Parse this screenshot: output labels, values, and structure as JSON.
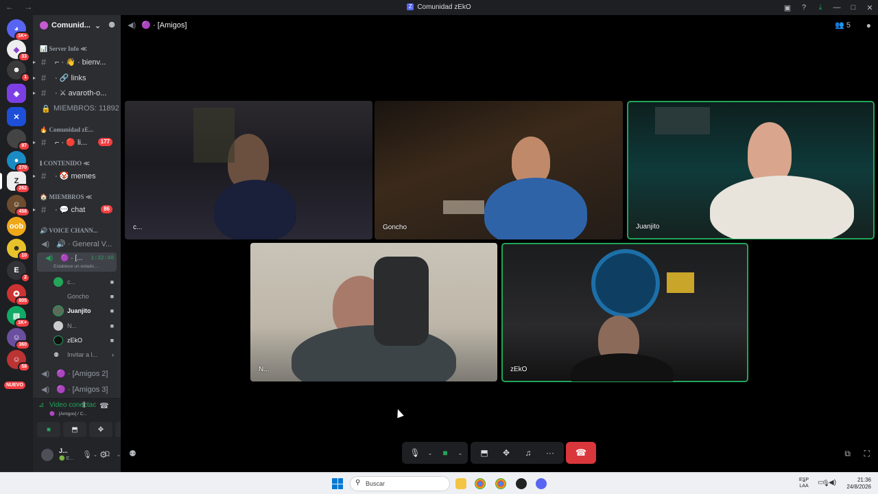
{
  "window": {
    "title": "Comunidad zEkO"
  },
  "guild_badges": [
    "1K+",
    "33",
    "1",
    "",
    "",
    "97",
    "270",
    "262",
    "458",
    "",
    "10",
    "2",
    "805",
    "1K+",
    "360",
    "58"
  ],
  "guild_letter": "E",
  "nuevo": "NUEVO",
  "server": {
    "name": "Comunid..."
  },
  "sidebar": {
    "cat_server_info": "📊 Server Info ≪",
    "ch_bienvenida": "⌐ · 👋 · bienv...",
    "ch_links": "· 🔗 links",
    "ch_avaroth": "· ⚔ avaroth-o...",
    "ch_miembros_count": "MIEMBROS: 11892",
    "cat_comunidad": "🔥 Comunidad zE...",
    "ch_li": "⌐ · 🔴 li...",
    "ch_li_count": "177",
    "cat_contenido": "ℹ CONTENIDO ≪",
    "ch_memes": "· 🤡 memes",
    "cat_miembros": "🏠 MIEMBROS ≪",
    "ch_chat": "· 💬 chat",
    "ch_chat_count": "86",
    "cat_voice": "🔊 VOICE CHANN...",
    "vc_general": "🔊 · General V...",
    "vc_amigos_active": "🟣 · [...",
    "vc_timer": "1:32:40",
    "vc_status": "Establece un estado ...",
    "members": [
      "c...",
      "Goncho",
      "Juanjito",
      "N...",
      "zEkO"
    ],
    "invite": "Invitar a l...",
    "vc_amigos2": "🟣 · [Amigos 2]",
    "vc_amigos3": "🟣 · [Amigos 3]"
  },
  "voice_panel": {
    "status": "Video conectac",
    "channel": "🟣 · [Amigos] / C..."
  },
  "user_panel": {
    "name": "J...",
    "sub": "🟢 E..."
  },
  "stage": {
    "channel": "🟣 · [Amigos]",
    "participant_count": "5"
  },
  "tiles": [
    {
      "label": "c...",
      "speaking": false
    },
    {
      "label": "Goncho",
      "speaking": false
    },
    {
      "label": "Juanjito",
      "speaking": true
    },
    {
      "label": "N...",
      "speaking": false
    },
    {
      "label": "zEkO",
      "speaking": true
    }
  ],
  "taskbar": {
    "search_placeholder": "Buscar",
    "lang1": "ESP",
    "lang2": "LAA",
    "time": "21:36",
    "date": "24/8/2026"
  }
}
